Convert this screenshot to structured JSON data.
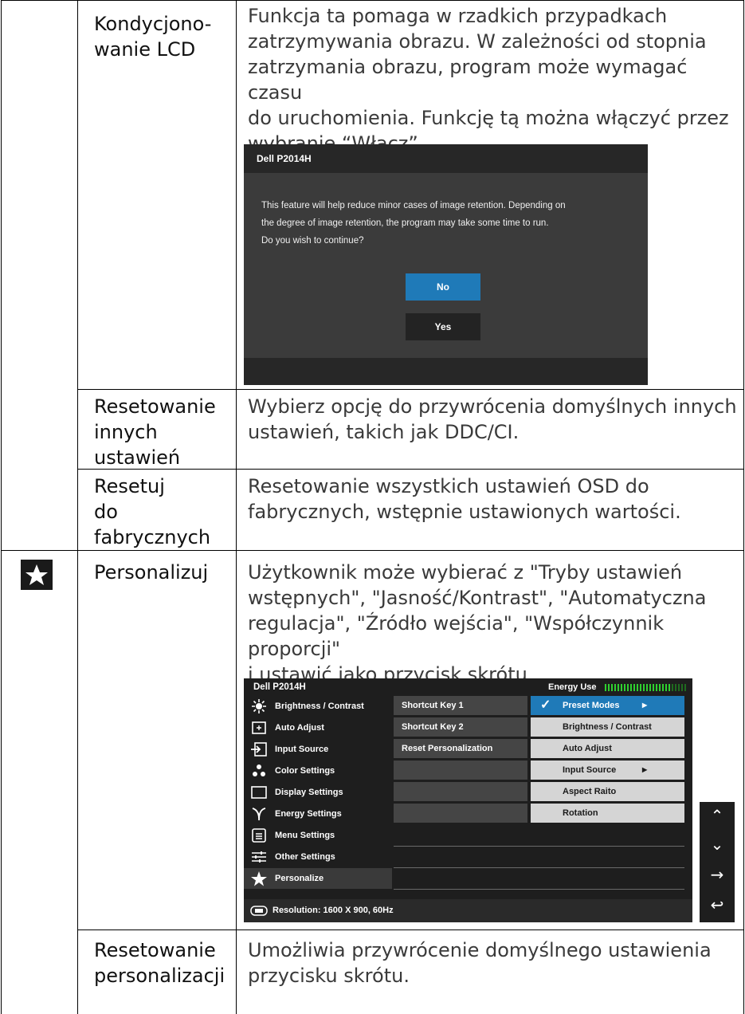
{
  "rows": {
    "lcd": {
      "label_lines": [
        "Kondycjono-",
        "wanie LCD"
      ],
      "desc_lines": [
        "Funkcja ta pomaga w rzadkich przypadkach",
        "zatrzymywania obrazu. W zależności od stopnia",
        "zatrzymania obrazu, program może wymagać czasu",
        "do uruchomienia. Funkcję tą można włączyć przez",
        "wybranie “Włącz”."
      ]
    },
    "reset_other": {
      "label_lines": [
        "Resetowanie",
        "innych",
        "ustawień"
      ],
      "desc_lines": [
        "Wybierz opcję do przywrócenia domyślnych innych",
        "ustawień, takich jak DDC/CI."
      ]
    },
    "reset_factory": {
      "label_lines": [
        "Resetuj",
        "do",
        "fabrycznych"
      ],
      "desc_lines": [
        "Resetowanie wszystkich ustawień OSD do",
        "fabrycznych, wstępnie ustawionych wartości."
      ]
    },
    "personalize": {
      "label_lines": [
        "Personalizuj"
      ],
      "desc_lines": [
        "Użytkownik może wybierać z \"Tryby ustawień",
        "wstępnych\", \"Jasność/Kontrast\", \"Automatyczna",
        "regulacja\", \"Źródło wejścia\", \"Współczynnik proporcji\"",
        "i ustawić jako przycisk skrótu."
      ]
    },
    "reset_personal": {
      "label_lines": [
        "Resetowanie",
        "personalizacji"
      ],
      "desc_lines": [
        "Umożliwia przywrócenie domyślnego ustawienia",
        "przycisku skrótu."
      ]
    }
  },
  "dialog": {
    "title": "Dell P2014H",
    "message_lines": [
      "This feature will help reduce minor cases of image retention. Depending on",
      "the degree of image retention, the program may take some time to run.",
      "Do you wish to continue?"
    ],
    "no_label": "No",
    "yes_label": "Yes",
    "accent": "#1f7ab8"
  },
  "osd": {
    "title": "Dell P2014H",
    "energy_label": "Energy Use",
    "energy_level": 0.8,
    "left_menu": [
      "Brightness / Contrast",
      "Auto Adjust",
      "Input Source",
      "Color Settings",
      "Display Settings",
      "Energy Settings",
      "Menu Settings",
      "Other Settings",
      "Personalize"
    ],
    "left_icons": [
      "sun-icon",
      "auto-adjust-icon",
      "input-source-icon",
      "color-dots-icon",
      "display-icon",
      "energy-leaf-icon",
      "menu-icon",
      "other-settings-icon",
      "star-icon"
    ],
    "mid_menu": [
      "Shortcut Key 1",
      "Shortcut Key 2",
      "Reset Personalization",
      "",
      "",
      ""
    ],
    "right_menu": [
      "Preset Modes",
      "Brightness / Contrast",
      "Auto Adjust",
      "Input Source",
      "Aspect Raito",
      "Rotation"
    ],
    "selected_check": "✓",
    "submenu_arrow": "▶",
    "footer": "Resolution:  1600 X 900, 60Hz",
    "accent": "#1f7ab8"
  },
  "nav": {
    "up": "⌃",
    "down": "⌄",
    "right": "→",
    "back": "↩"
  }
}
